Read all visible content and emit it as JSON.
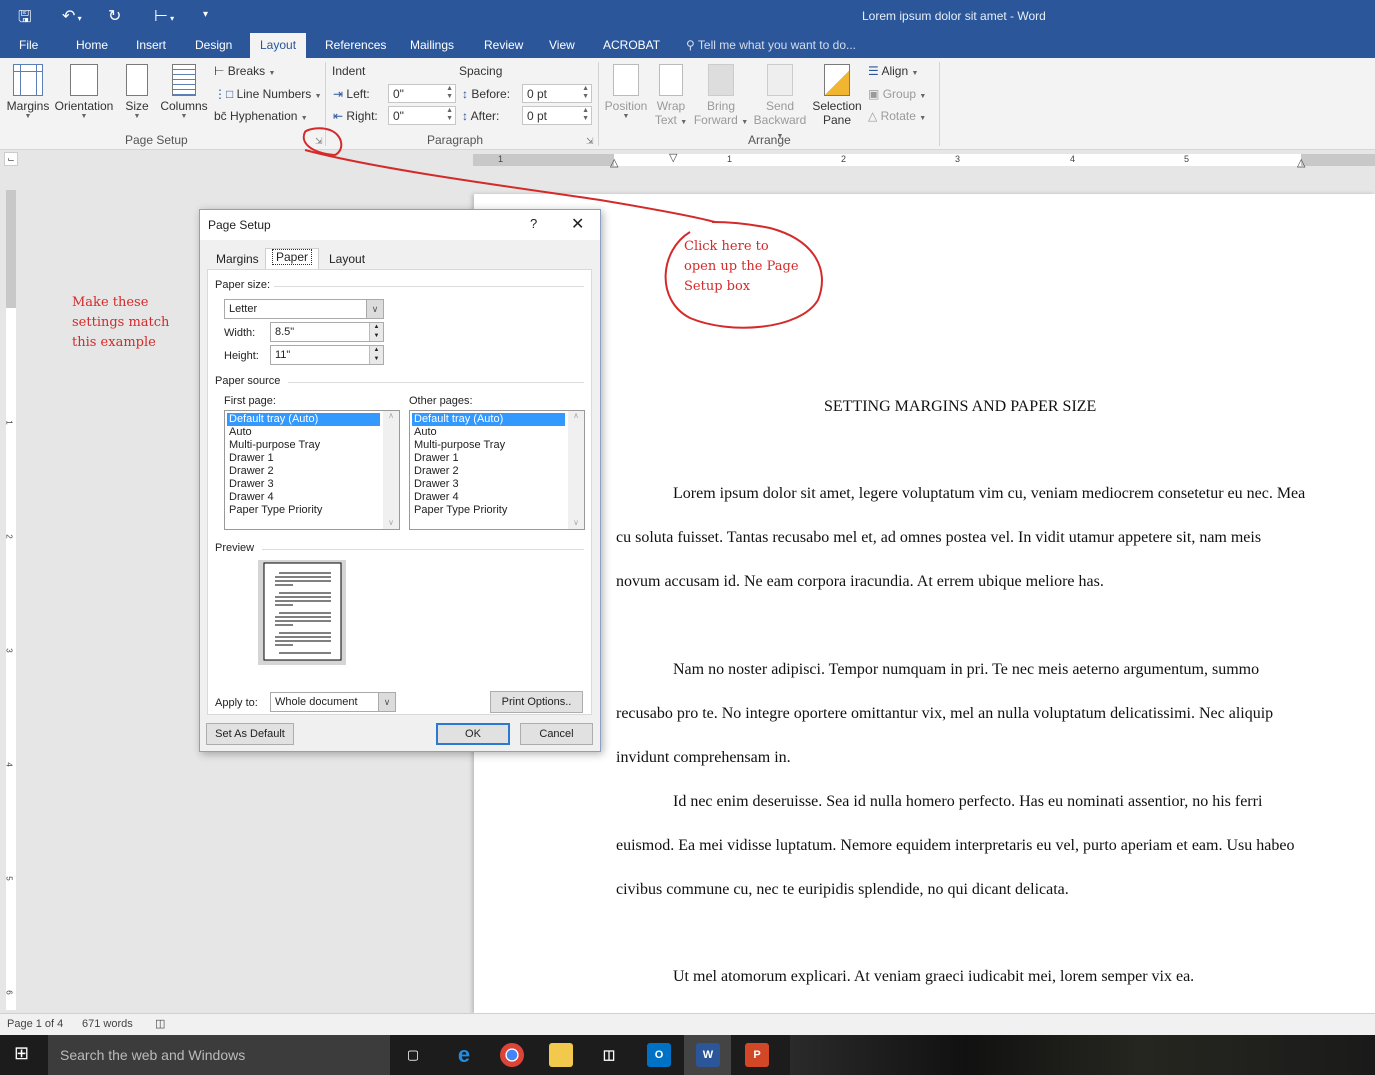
{
  "titlebar": {
    "title": "Lorem ipsum dolor sit amet - Word",
    "quick_access": [
      "save-icon",
      "undo-icon",
      "redo-icon",
      "touch-mode-icon",
      "customize-icon"
    ]
  },
  "tabs": {
    "items": [
      "File",
      "Home",
      "Insert",
      "Design",
      "Layout",
      "References",
      "Mailings",
      "Review",
      "View",
      "ACROBAT"
    ],
    "active": "Layout",
    "tellme": "Tell me what you want to do..."
  },
  "ribbon": {
    "page_setup": {
      "label": "Page Setup",
      "margins": "Margins",
      "orientation": "Orientation",
      "size": "Size",
      "columns": "Columns",
      "breaks": "Breaks",
      "line_numbers": "Line Numbers",
      "hyphenation": "Hyphenation"
    },
    "paragraph": {
      "label": "Paragraph",
      "indent": "Indent",
      "spacing": "Spacing",
      "left_label": "Left:",
      "left_value": "0\"",
      "right_label": "Right:",
      "right_value": "0\"",
      "before_label": "Before:",
      "before_value": "0 pt",
      "after_label": "After:",
      "after_value": "0 pt"
    },
    "arrange": {
      "label": "Arrange",
      "position": "Position",
      "wrap_text_1": "Wrap",
      "wrap_text_2": "Text",
      "bring_forward_1": "Bring",
      "bring_forward_2": "Forward",
      "send_backward_1": "Send",
      "send_backward_2": "Backward",
      "selection_pane_1": "Selection",
      "selection_pane_2": "Pane",
      "align": "Align",
      "group": "Group",
      "rotate": "Rotate"
    }
  },
  "ruler": {
    "numbers": [
      "1",
      "1",
      "2",
      "3",
      "4",
      "5"
    ],
    "vertical_numbers": [
      "1",
      "2",
      "3",
      "4",
      "5",
      "6"
    ]
  },
  "document": {
    "title": "SETTING MARGINS AND PAPER SIZE",
    "paragraphs": [
      "Lorem ipsum dolor sit amet, legere voluptatum vim cu, veniam mediocrem consetetur eu nec. Mea cu soluta fuisset. Tantas recusabo mel et, ad omnes postea vel. In vidit utamur appetere sit, nam meis novum accusam id. Ne eam corpora iracundia. At errem ubique meliore has.",
      "Nam no noster adipisci. Tempor numquam in pri. Te nec meis aeterno argumentum, summo recusabo pro te. No integre oportere omittantur vix, mel an nulla voluptatum delicatissimi. Nec aliquip invidunt comprehensam in.",
      "Id nec enim deseruisse. Sea id nulla homero perfecto. Has eu nominati assentior, no his ferri euismod. Ea mei vidisse luptatum. Nemore equidem interpretaris eu vel, purto aperiam et eam. Usu habeo civibus commune cu, nec te euripidis splendide, no qui dicant delicata.",
      "Ut mel atomorum explicari. At veniam graeci iudicabit mei, lorem semper vix ea."
    ]
  },
  "annotations": {
    "left": [
      "Make these",
      "settings match",
      "this example"
    ],
    "circle": [
      "Click here to",
      "open up the Page",
      "Setup box"
    ],
    "color": "#d42a2a"
  },
  "dialog": {
    "title": "Page Setup",
    "help": "?",
    "close": "✕",
    "tabs": [
      "Margins",
      "Paper",
      "Layout"
    ],
    "active_tab": "Paper",
    "paper_size_label": "Paper size:",
    "paper_size_value": "Letter",
    "width_label": "Width:",
    "width_value": "8.5\"",
    "height_label": "Height:",
    "height_value": "11\"",
    "paper_source_label": "Paper source",
    "first_page_label": "First page:",
    "other_pages_label": "Other pages:",
    "source_items": [
      "Default tray (Auto)",
      "Auto",
      "Multi-purpose Tray",
      "Drawer 1",
      "Drawer 2",
      "Drawer 3",
      "Drawer 4",
      "Paper Type Priority"
    ],
    "first_page_selected": "Default tray (Auto)",
    "other_pages_selected": "Default tray (Auto)",
    "preview_label": "Preview",
    "apply_to_label": "Apply to:",
    "apply_to_value": "Whole document",
    "print_options": "Print Options..",
    "set_default": "Set As Default",
    "ok": "OK",
    "cancel": "Cancel"
  },
  "statusbar": {
    "page": "Page 1 of 4",
    "words": "671 words"
  },
  "taskbar": {
    "search_placeholder": "Search the web and Windows",
    "apps": [
      "task-view",
      "edge",
      "chrome",
      "file-explorer",
      "store",
      "outlook",
      "word",
      "powerpoint"
    ]
  }
}
